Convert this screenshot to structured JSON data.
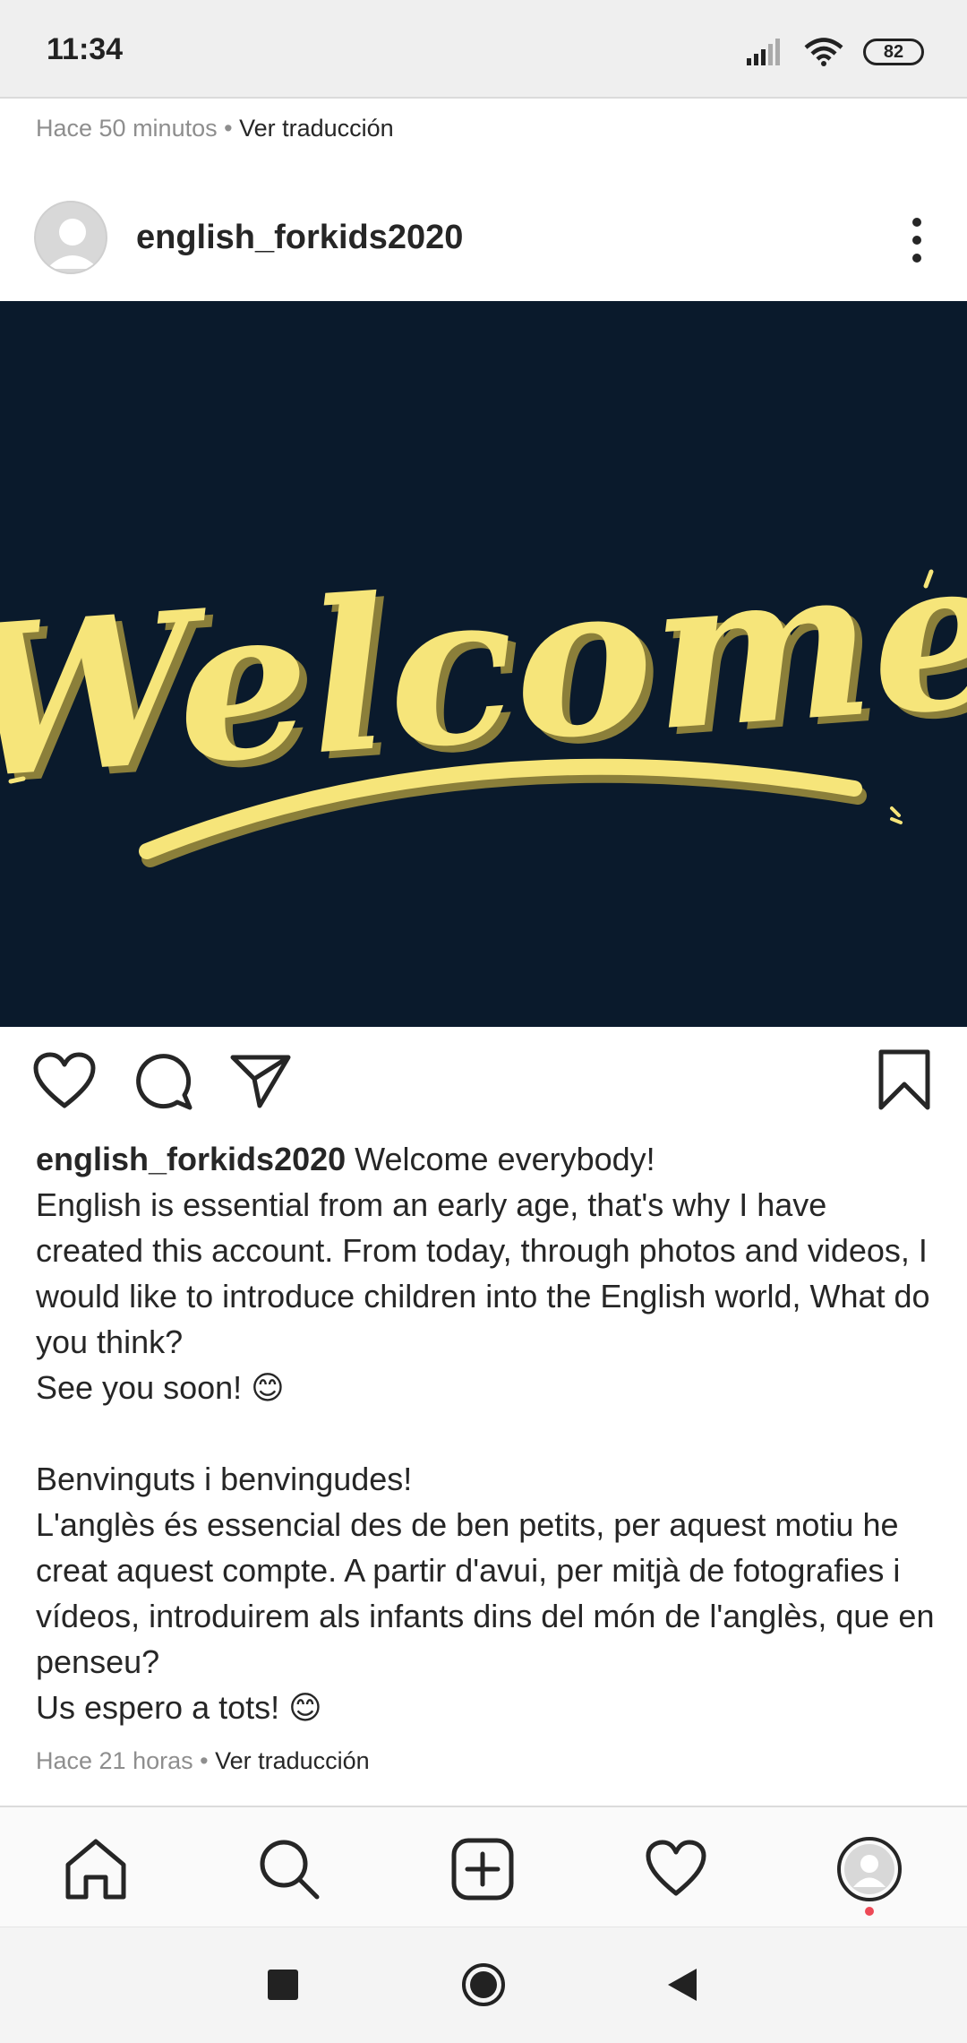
{
  "status_bar": {
    "time": "11:34",
    "battery": "82",
    "icons": [
      "signal-icon",
      "wifi-icon",
      "battery-icon"
    ]
  },
  "previous_post": {
    "timestamp": "Hace 50 minutos",
    "separator": "•",
    "translate_link": "Ver traducción"
  },
  "post": {
    "username": "english_forkids2020",
    "image_text": "Welcome",
    "caption_lead": "Welcome everybody!",
    "caption_body": "English is essential from an early age, that's why I have created this account. From today, through photos and videos, I would like to introduce children into the English world, What do you think?\nSee you soon! 😊\n\nBenvinguts i benvingudes!\nL'anglès és essencial des de ben petits, per aquest motiu he creat aquest compte. A partir d'avui, per mitjà de fotografies i vídeos, introduirem als infants dins del món de l'anglès, que en penseu?\nUs espero a tots! 😊",
    "timestamp": "Hace 21 horas",
    "separator": "•",
    "translate_link": "Ver traducción"
  },
  "actions": [
    "heart-icon",
    "comment-icon",
    "share-icon",
    "bookmark-icon"
  ],
  "bottom_nav": [
    "home-icon",
    "search-icon",
    "add-post-icon",
    "activity-heart-icon",
    "profile-icon"
  ],
  "colors": {
    "image_bg": "#0a1a2c",
    "welcome_yellow": "#f6e57a",
    "notification_dot": "#ed4956"
  }
}
